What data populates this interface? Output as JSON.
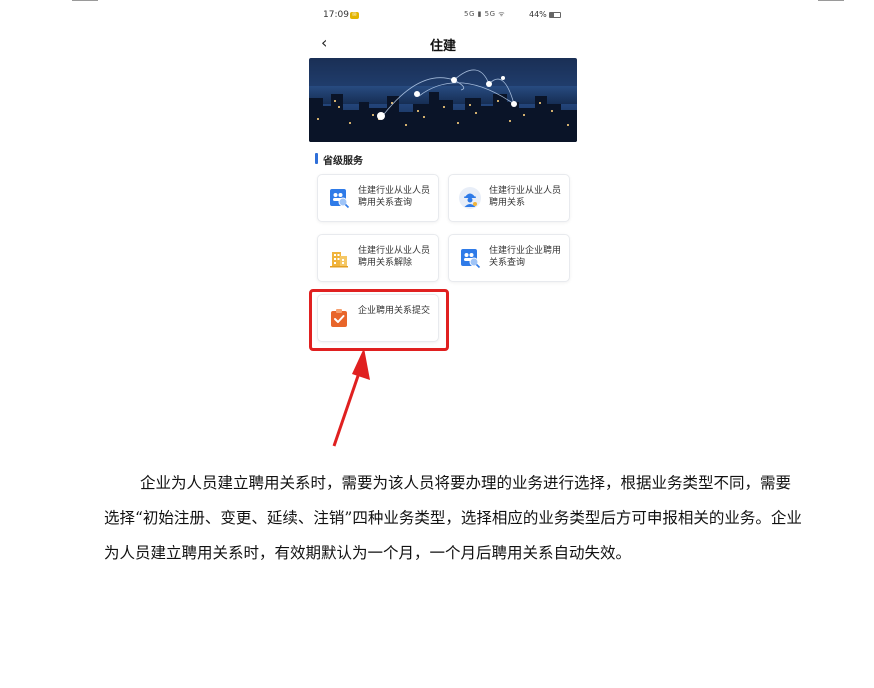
{
  "status_bar": {
    "time": "17:09",
    "notification": "✉",
    "network_icons": "5G ▮ 5G ᯤ",
    "battery_text": "44%",
    "battery_level": 0.44
  },
  "nav": {
    "back_icon": "chevron-left-icon",
    "title": "住建"
  },
  "banner": {
    "image": "city-night-skyline-with-location-pins"
  },
  "section": {
    "title": "省级服务"
  },
  "services": [
    {
      "label": "住建行业从业人员聘用关系查询",
      "icon": "people-search-icon",
      "color": "#2f7be8"
    },
    {
      "label": "住建行业从业人员聘用关系",
      "icon": "worker-icon",
      "color": "#2f7be8"
    },
    {
      "label": "住建行业从业人员聘用关系解除",
      "icon": "building-icon",
      "color": "#f0b43c"
    },
    {
      "label": "住建行业企业聘用关系查询",
      "icon": "people-search-icon",
      "color": "#2f7be8"
    },
    {
      "label": "企业聘用关系提交",
      "icon": "clipboard-check-icon",
      "color": "#e8652a"
    }
  ],
  "annotation": {
    "highlight_color": "#e02020"
  },
  "paragraph": "企业为人员建立聘用关系时，需要为该人员将要办理的业务进行选择，根据业务类型不同，需要选择“初始注册、变更、延续、注销”四种业务类型，选择相应的业务类型后方可申报相关的业务。企业为人员建立聘用关系时，有效期默认为一个月，一个月后聘用关系自动失效。"
}
